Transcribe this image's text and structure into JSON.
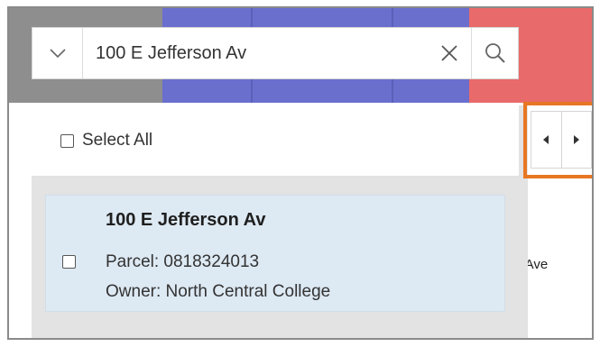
{
  "search": {
    "value": "100 E Jefferson Av",
    "placeholder": ""
  },
  "results": {
    "select_all_label": "Select All",
    "items": [
      {
        "title": "100 E Jefferson Av",
        "parcel": "Parcel: 0818324013",
        "owner": "Owner: North Central College"
      }
    ]
  },
  "map": {
    "street_label_partial": "n Ave"
  },
  "colors": {
    "accent_highlight": "#e87722",
    "result_selected_bg": "#dde9f3",
    "map_gray": "#8e8e8e",
    "map_blue": "#6a6fce",
    "map_red": "#e96a6a"
  },
  "icons": {
    "dropdown": "chevron-down-icon",
    "clear": "close-icon",
    "search": "search-icon",
    "prev": "caret-left-icon",
    "next": "caret-right-icon"
  }
}
